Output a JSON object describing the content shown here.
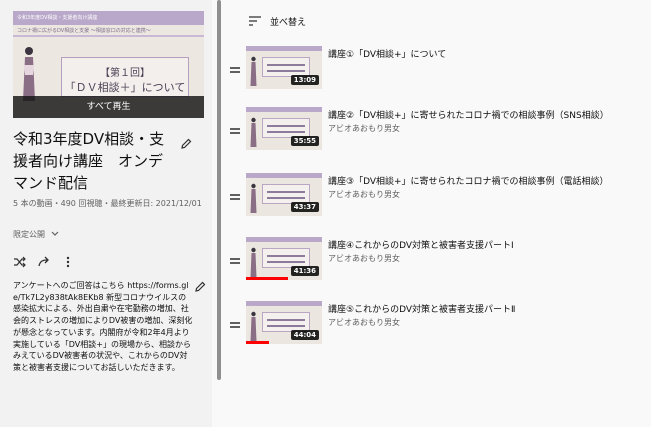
{
  "playlist": {
    "hero": {
      "top_text": "令和3年度DV相談・支援者向け講座",
      "sub_text": "コロナ禍に広がるDV相談と支援 〜相談窓口の対応と連携〜",
      "card_line1": "【第１回】",
      "card_line2": "「ＤＶ相談＋」について",
      "play_all_label": "すべて再生"
    },
    "title": "令和3年度DV相談・支援者向け講座　オンデマンド配信",
    "meta": "5 本の動画・490 回視聴・最終更新日: 2021/12/01",
    "privacy": "限定公開",
    "description": "アンケートへのご回答はこちら https://forms.gle/Tk7L2y838tAk8EKb8 新型コロナウイルスの感染拡大による、外出自粛や在宅勤務の増加、社会的ストレスの増加によりDV被害の増加、深刻化が懸念となっています。内閣府が令和2年4月より実施している「DV相談+」の現場から、相談からみえているDV被害者の状況や、これからのDV対策と被害者支援についてお話しいただきます。"
  },
  "list": {
    "sort_label": "並べ替え",
    "videos": [
      {
        "title": "講座①「DV相談+」について",
        "channel": "",
        "duration": "13:09",
        "progress": 0
      },
      {
        "title": "講座②「DV相談+」に寄せられたコロナ禍での相談事例（SNS相談）",
        "channel": "アビオあおもり男女",
        "duration": "35:55",
        "progress": 0
      },
      {
        "title": "講座③「DV相談+」に寄せられたコロナ禍での相談事例（電話相談）",
        "channel": "アビオあおもり男女",
        "duration": "43:37",
        "progress": 0
      },
      {
        "title": "講座④これからのDV対策と被害者支援パートⅠ",
        "channel": "アビオあおもり男女",
        "duration": "41:36",
        "progress": 0.55
      },
      {
        "title": "講座⑤これからのDV対策と被害者支援パートⅡ",
        "channel": "アビオあおもり男女",
        "duration": "44:04",
        "progress": 0.3
      }
    ]
  },
  "icons": {
    "edit": "pencil-icon",
    "shuffle": "shuffle-icon",
    "share": "share-icon",
    "more": "more-vert-icon",
    "sort": "sort-icon",
    "drag": "drag-handle-icon",
    "dropdown": "chevron-down-icon"
  },
  "colors": {
    "accent": "#ff0000",
    "thumb_bg": "#ece6e1",
    "thumb_band": "#b9a8c9"
  }
}
